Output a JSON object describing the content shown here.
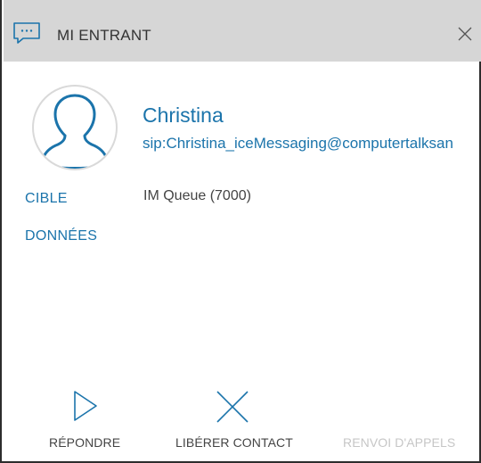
{
  "window": {
    "title": "MI ENTRANT",
    "icon": "chat-bubble-icon",
    "close_icon": "close-icon"
  },
  "contact": {
    "name": "Christina",
    "sip": "sip:Christina_iceMessaging@computertalksan",
    "avatar_icon": "person-avatar-icon"
  },
  "nav": {
    "cible": "CIBLE",
    "donnees": "DONNÉES"
  },
  "queue": "IM Queue (7000)",
  "actions": {
    "answer": {
      "label": "RÉPONDRE",
      "icon": "play-icon"
    },
    "release": {
      "label": "LIBÉRER CONTACT",
      "icon": "x-icon"
    },
    "forward": {
      "label": "RENVOI D'APPELS",
      "enabled": false
    }
  },
  "colors": {
    "accent": "#1b74ab",
    "titlebar": "#d6d6d6",
    "disabled": "#c6c6c6"
  }
}
